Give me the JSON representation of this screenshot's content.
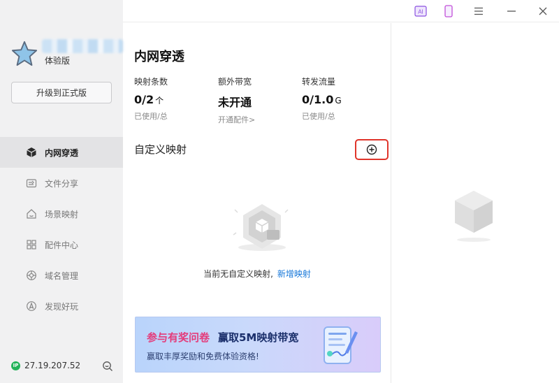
{
  "sidebar": {
    "edition": "体验版",
    "upgrade_label": "升级到正式版",
    "items": [
      {
        "label": "内网穿透",
        "icon": "cube-icon",
        "active": true
      },
      {
        "label": "文件分享",
        "icon": "folder-share-icon",
        "active": false
      },
      {
        "label": "场景映射",
        "icon": "home-icon",
        "active": false
      },
      {
        "label": "配件中心",
        "icon": "grid-icon",
        "active": false
      },
      {
        "label": "域名管理",
        "icon": "globe-icon",
        "active": false
      },
      {
        "label": "发现好玩",
        "icon": "compass-icon",
        "active": false
      }
    ],
    "ip_badge": "IP",
    "ip": "27.19.207.52"
  },
  "titlebar": {
    "ai_label": "AI"
  },
  "main": {
    "title": "内网穿透",
    "stats": [
      {
        "label": "映射条数",
        "value": "0/2",
        "unit": "个",
        "sub": "已使用/总"
      },
      {
        "label": "额外带宽",
        "value": "未开通",
        "unit": "",
        "sub": "开通配件>"
      },
      {
        "label": "转发流量",
        "value": "0/1.0",
        "unit": "G",
        "sub": "已使用/总"
      }
    ],
    "section_title": "自定义映射",
    "empty_text": "当前无自定义映射,",
    "empty_link": "新增映射",
    "banner": {
      "headline_highlight": "参与有奖问卷",
      "headline_rest": "赢取5M映射带宽",
      "subtext": "赢取丰厚奖励和免费体验资格!"
    }
  },
  "colors": {
    "accent_red": "#e0352b",
    "link_blue": "#1677d9",
    "ip_green": "#24b35a",
    "ai_purple": "#8a4fe0"
  }
}
